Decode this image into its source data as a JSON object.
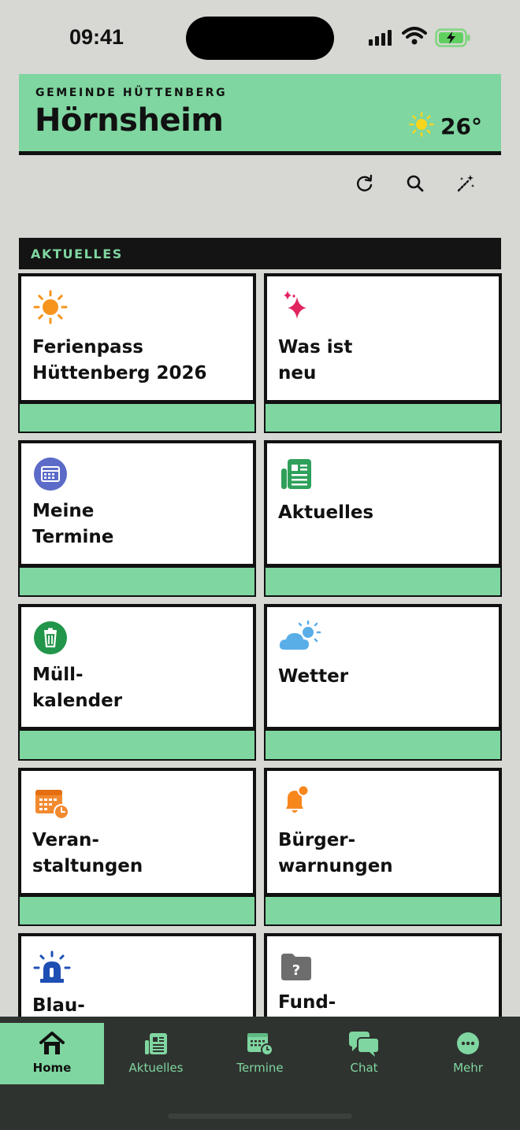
{
  "status_bar": {
    "time": "09:41"
  },
  "header": {
    "kicker": "GEMEINDE HÜTTENBERG",
    "title": "Hörnsheim",
    "weather_icon": "sun-icon",
    "temperature": "26°"
  },
  "toolbar": {
    "buttons": [
      {
        "icon": "refresh-icon"
      },
      {
        "icon": "search-icon"
      },
      {
        "icon": "magic-wand-icon"
      }
    ]
  },
  "section": {
    "title": "AKTUELLES"
  },
  "tiles": [
    {
      "label": "Ferienpass\nHüttenberg 2026",
      "icon": "sun-icon",
      "color": "#f7941d"
    },
    {
      "label": "Was ist\nneu",
      "icon": "sparkles-icon",
      "color": "#e0245e"
    },
    {
      "label": "Meine\nTermine",
      "icon": "calendar-icon",
      "color": "#5b6bc7"
    },
    {
      "label": "Aktuelles",
      "icon": "newspaper-icon",
      "color": "#2ea05a"
    },
    {
      "label": "Müll-\nkalender",
      "icon": "trash-icon",
      "color": "#22964a"
    },
    {
      "label": "Wetter",
      "icon": "cloud-sun-icon",
      "color": "#5aaee8"
    },
    {
      "label": "Veran-\nstaltungen",
      "icon": "event-calendar-icon",
      "color": "#f28a30"
    },
    {
      "label": "Bürger-\nwarnungen",
      "icon": "bell-icon",
      "color": "#f7861d"
    },
    {
      "label": "Blau-",
      "icon": "siren-icon",
      "color": "#1e4fb4"
    },
    {
      "label": "Fund-",
      "icon": "folder-question-icon",
      "color": "#6d6d6d"
    }
  ],
  "nav": {
    "items": [
      {
        "label": "Home",
        "icon": "home-icon",
        "active": true
      },
      {
        "label": "Aktuelles",
        "icon": "newspaper-icon",
        "active": false
      },
      {
        "label": "Termine",
        "icon": "calendar-icon",
        "active": false
      },
      {
        "label": "Chat",
        "icon": "chat-icon",
        "active": false
      },
      {
        "label": "Mehr",
        "icon": "more-icon",
        "active": false
      }
    ]
  },
  "colors": {
    "accent_green": "#7fd6a0",
    "dark": "#141414",
    "background": "#d7d7d3",
    "nav_background": "#2f332f"
  }
}
